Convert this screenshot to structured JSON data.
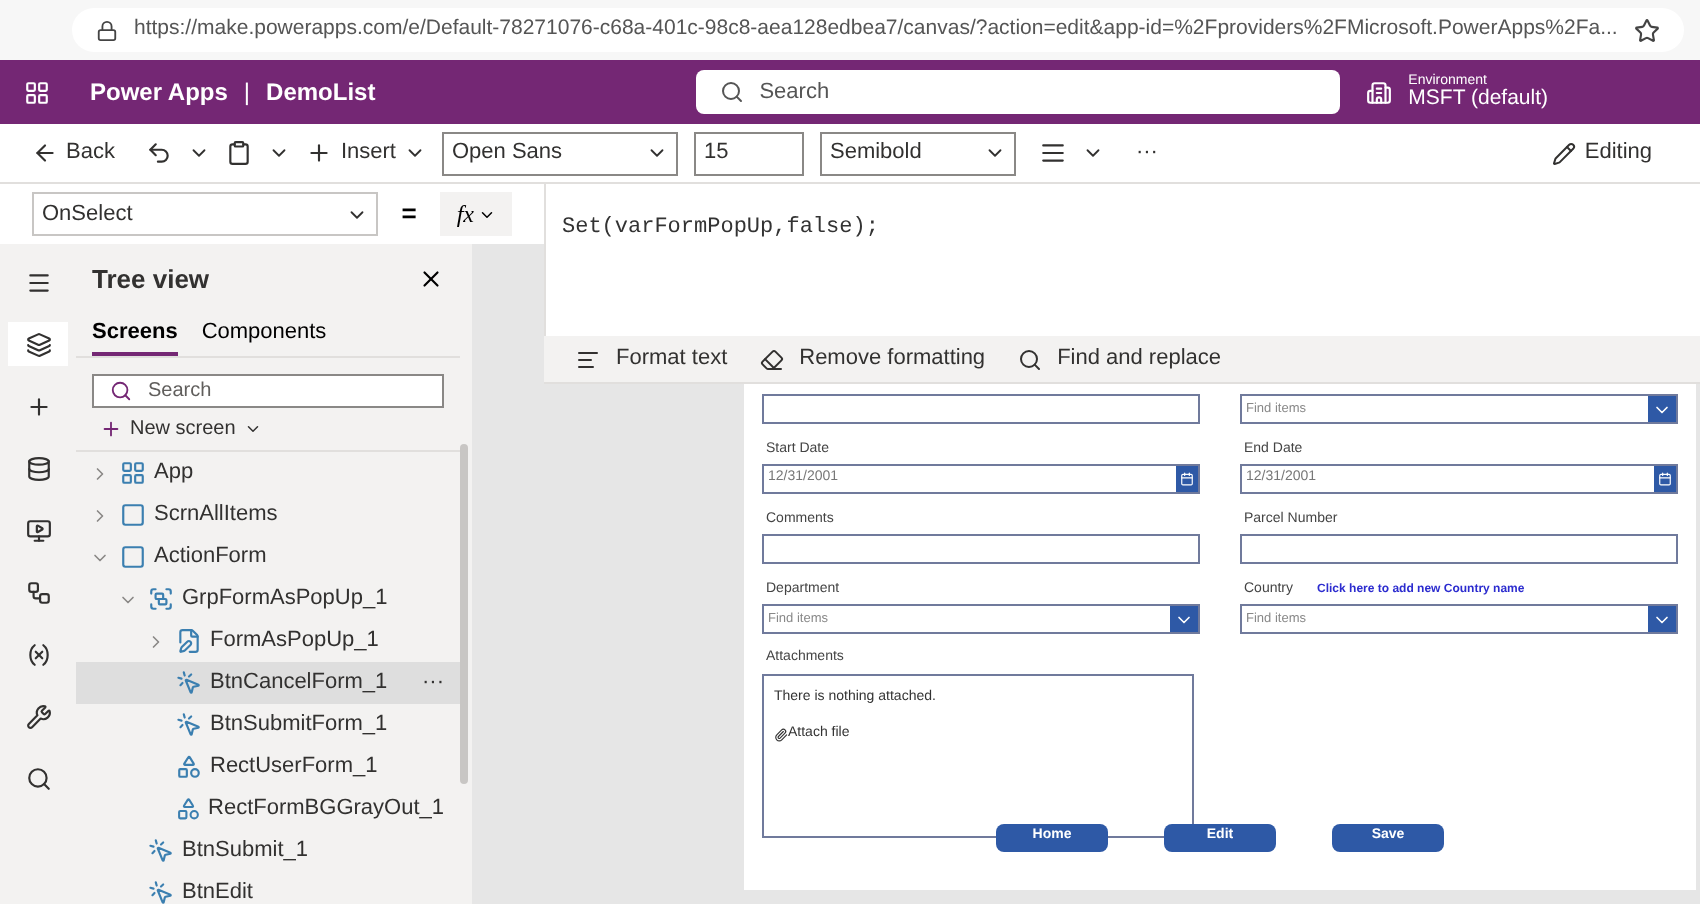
{
  "browser": {
    "url": "https://make.powerapps.com/e/Default-78271076-c68a-401c-98c8-aea128edbea7/canvas/?action=edit&app-id=%2Fproviders%2FMicrosoft.PowerApps%2Fa..."
  },
  "header": {
    "product": "Power Apps",
    "separator": "|",
    "app_name": "DemoList",
    "search_placeholder": "Search",
    "environment_label": "Environment",
    "environment": "MSFT (default)"
  },
  "toolbar": {
    "back": "Back",
    "insert": "Insert",
    "font": "Open Sans",
    "font_size": "15",
    "font_weight": "Semibold",
    "more": "···",
    "editing": "Editing"
  },
  "formula_bar": {
    "property": "OnSelect",
    "equals": "=",
    "fx": "fx",
    "formula": "Set(varFormPopUp,false);"
  },
  "format_bar": [
    {
      "kind": "format",
      "label": "Format text"
    },
    {
      "kind": "remove",
      "label": "Remove formatting"
    },
    {
      "kind": "find",
      "label": "Find and replace"
    }
  ],
  "rail": [
    {
      "kind": "menu",
      "selected": false
    },
    {
      "kind": "layers",
      "selected": true
    },
    {
      "kind": "plus",
      "selected": false
    },
    {
      "kind": "database",
      "selected": false
    },
    {
      "kind": "media",
      "selected": false
    },
    {
      "kind": "flow",
      "selected": false
    },
    {
      "kind": "variables",
      "selected": false
    },
    {
      "kind": "tools",
      "selected": false
    },
    {
      "kind": "search",
      "selected": false
    }
  ],
  "tree_view": {
    "title": "Tree view",
    "tabs": [
      {
        "label": "Screens",
        "selected": true
      },
      {
        "label": "Components",
        "selected": false
      }
    ],
    "search_placeholder": "Search",
    "new_screen": "New screen",
    "items": [
      {
        "label": "App",
        "kind": "app",
        "expanded": false,
        "selected": false
      },
      {
        "label": "ScrnAllItems",
        "kind": "screen",
        "expanded": false,
        "selected": false
      },
      {
        "label": "ActionForm",
        "kind": "screen",
        "expanded": true,
        "selected": false,
        "children": [
          {
            "label": "GrpFormAsPopUp_1",
            "kind": "group",
            "expanded": true,
            "selected": false,
            "children": [
              {
                "label": "FormAsPopUp_1",
                "kind": "form",
                "expanded": false,
                "selected": false
              },
              {
                "label": "BtnCancelForm_1",
                "kind": "button",
                "selected": true,
                "more": "···"
              },
              {
                "label": "BtnSubmitForm_1",
                "kind": "button",
                "selected": false
              },
              {
                "label": "RectUserForm_1",
                "kind": "rectangle",
                "selected": false
              },
              {
                "label": "RectFormBGGrayOut_1",
                "kind": "rectangle",
                "selected": false
              }
            ]
          },
          {
            "label": "BtnSubmit_1",
            "kind": "button",
            "selected": false
          },
          {
            "label": "BtnEdit",
            "kind": "button",
            "selected": false
          }
        ]
      }
    ]
  },
  "form": {
    "rows": [
      [
        {
          "kind": "text"
        },
        {
          "kind": "dropdown",
          "placeholder": "Find items"
        }
      ],
      [
        {
          "kind": "date",
          "label": "Start Date",
          "value": "12/31/2001"
        },
        {
          "kind": "date",
          "label": "End Date",
          "value": "12/31/2001"
        }
      ],
      [
        {
          "kind": "text",
          "label": "Comments"
        },
        {
          "kind": "text",
          "label": "Parcel Number"
        }
      ],
      [
        {
          "kind": "dropdown",
          "label": "Department",
          "placeholder": "Find items"
        },
        {
          "kind": "dropdown",
          "label": "Country",
          "link": "Click here to add new Country name",
          "placeholder": "Find items"
        }
      ]
    ],
    "attachments": {
      "label": "Attachments",
      "empty_text": "There is nothing attached.",
      "attach": "Attach file"
    },
    "buttons": [
      "Home",
      "Edit",
      "Save"
    ]
  }
}
